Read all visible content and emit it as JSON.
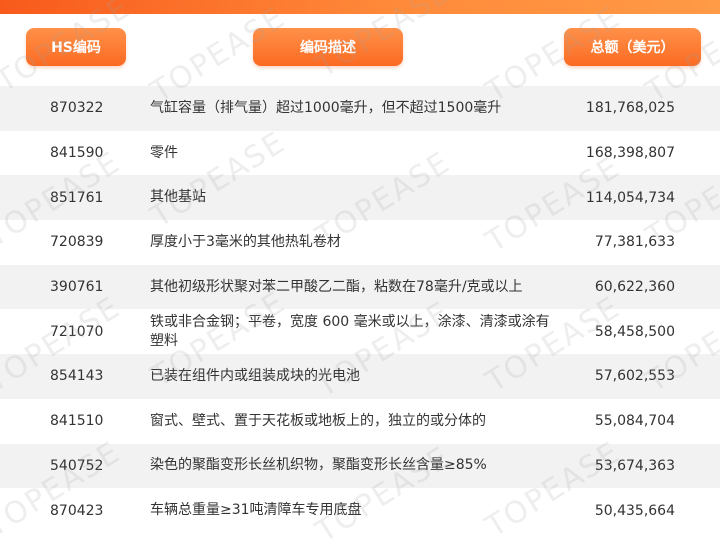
{
  "header": {
    "hs_label": "HS编码",
    "desc_label": "编码描述",
    "total_label": "总额（美元）"
  },
  "rows": [
    {
      "hs": "870322",
      "desc": "气缸容量（排气量）超过1000毫升，但不超过1500毫升",
      "total": "181,768,025"
    },
    {
      "hs": "841590",
      "desc": "零件",
      "total": "168,398,807"
    },
    {
      "hs": "851761",
      "desc": "其他基站",
      "total": "114,054,734"
    },
    {
      "hs": "720839",
      "desc": "厚度小于3毫米的其他热轧卷材",
      "total": "77,381,633"
    },
    {
      "hs": "390761",
      "desc": "其他初级形状聚对苯二甲酸乙二酯，粘数在78毫升/克或以上",
      "total": "60,622,360"
    },
    {
      "hs": "721070",
      "desc": "铁或非合金钢；平卷，宽度 600 毫米或以上，涂漆、清漆或涂有塑料",
      "total": "58,458,500"
    },
    {
      "hs": "854143",
      "desc": "已装在组件内或组装成块的光电池",
      "total": "57,602,553"
    },
    {
      "hs": "841510",
      "desc": "窗式、壁式、置于天花板或地板上的，独立的或分体的",
      "total": "55,084,704"
    },
    {
      "hs": "540752",
      "desc": "染色的聚酯变形长丝机织物，聚酯变形长丝含量≥85%",
      "total": "53,674,363"
    },
    {
      "hs": "870423",
      "desc": "车辆总重量≥31吨清障车专用底盘",
      "total": "50,435,664"
    }
  ],
  "watermark": {
    "text": "TOPEASE"
  },
  "colors": {
    "accent": "#fb6a22",
    "stripe": "#f2f2f2"
  }
}
